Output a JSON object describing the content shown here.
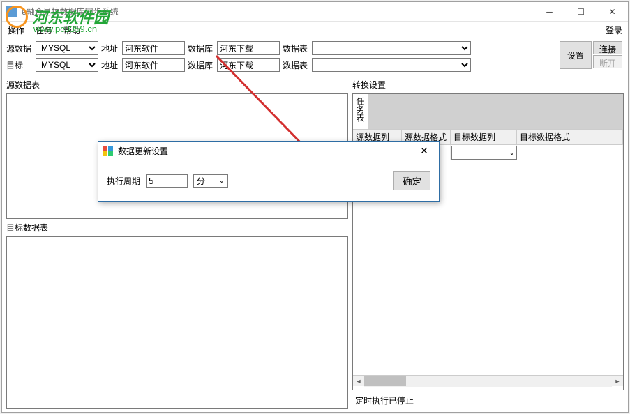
{
  "titlebar": {
    "text": "e融合易拉数据库同步系统"
  },
  "menu": {
    "operate": "操作",
    "task": "任务",
    "help": "帮助",
    "login": "登录"
  },
  "toolbar": {
    "row1": {
      "src_label": "源数据",
      "type_value": "MYSQL",
      "addr_label": "地址",
      "addr_value": "河东软件",
      "db_label": "数据库",
      "db_value": "河东下载",
      "table_label": "数据表",
      "table_value": ""
    },
    "row2": {
      "tgt_label": "目标",
      "type_value": "MYSQL",
      "addr_label": "地址",
      "addr_value": "河东软件",
      "db_label": "数据库",
      "db_value": "河东下载",
      "table_label": "数据表",
      "table_value": ""
    },
    "buttons": {
      "settings": "设置",
      "connect": "连接",
      "disconnect": "断开"
    }
  },
  "panels": {
    "src_label": "源数据表",
    "tgt_label": "目标数据表",
    "convert_label": "转换设置",
    "task_list": "任务表"
  },
  "grid": {
    "headers": [
      "源数据列",
      "源数据格式",
      "目标数据列",
      "目标数据格式"
    ]
  },
  "status": {
    "text": "定时执行已停止"
  },
  "dialog": {
    "title": "数据更新设置",
    "period_label": "执行周期",
    "period_value": "5",
    "unit_value": "分",
    "ok": "确定"
  },
  "watermark": {
    "name": "河东软件园",
    "url": "www.pc0359.cn"
  }
}
